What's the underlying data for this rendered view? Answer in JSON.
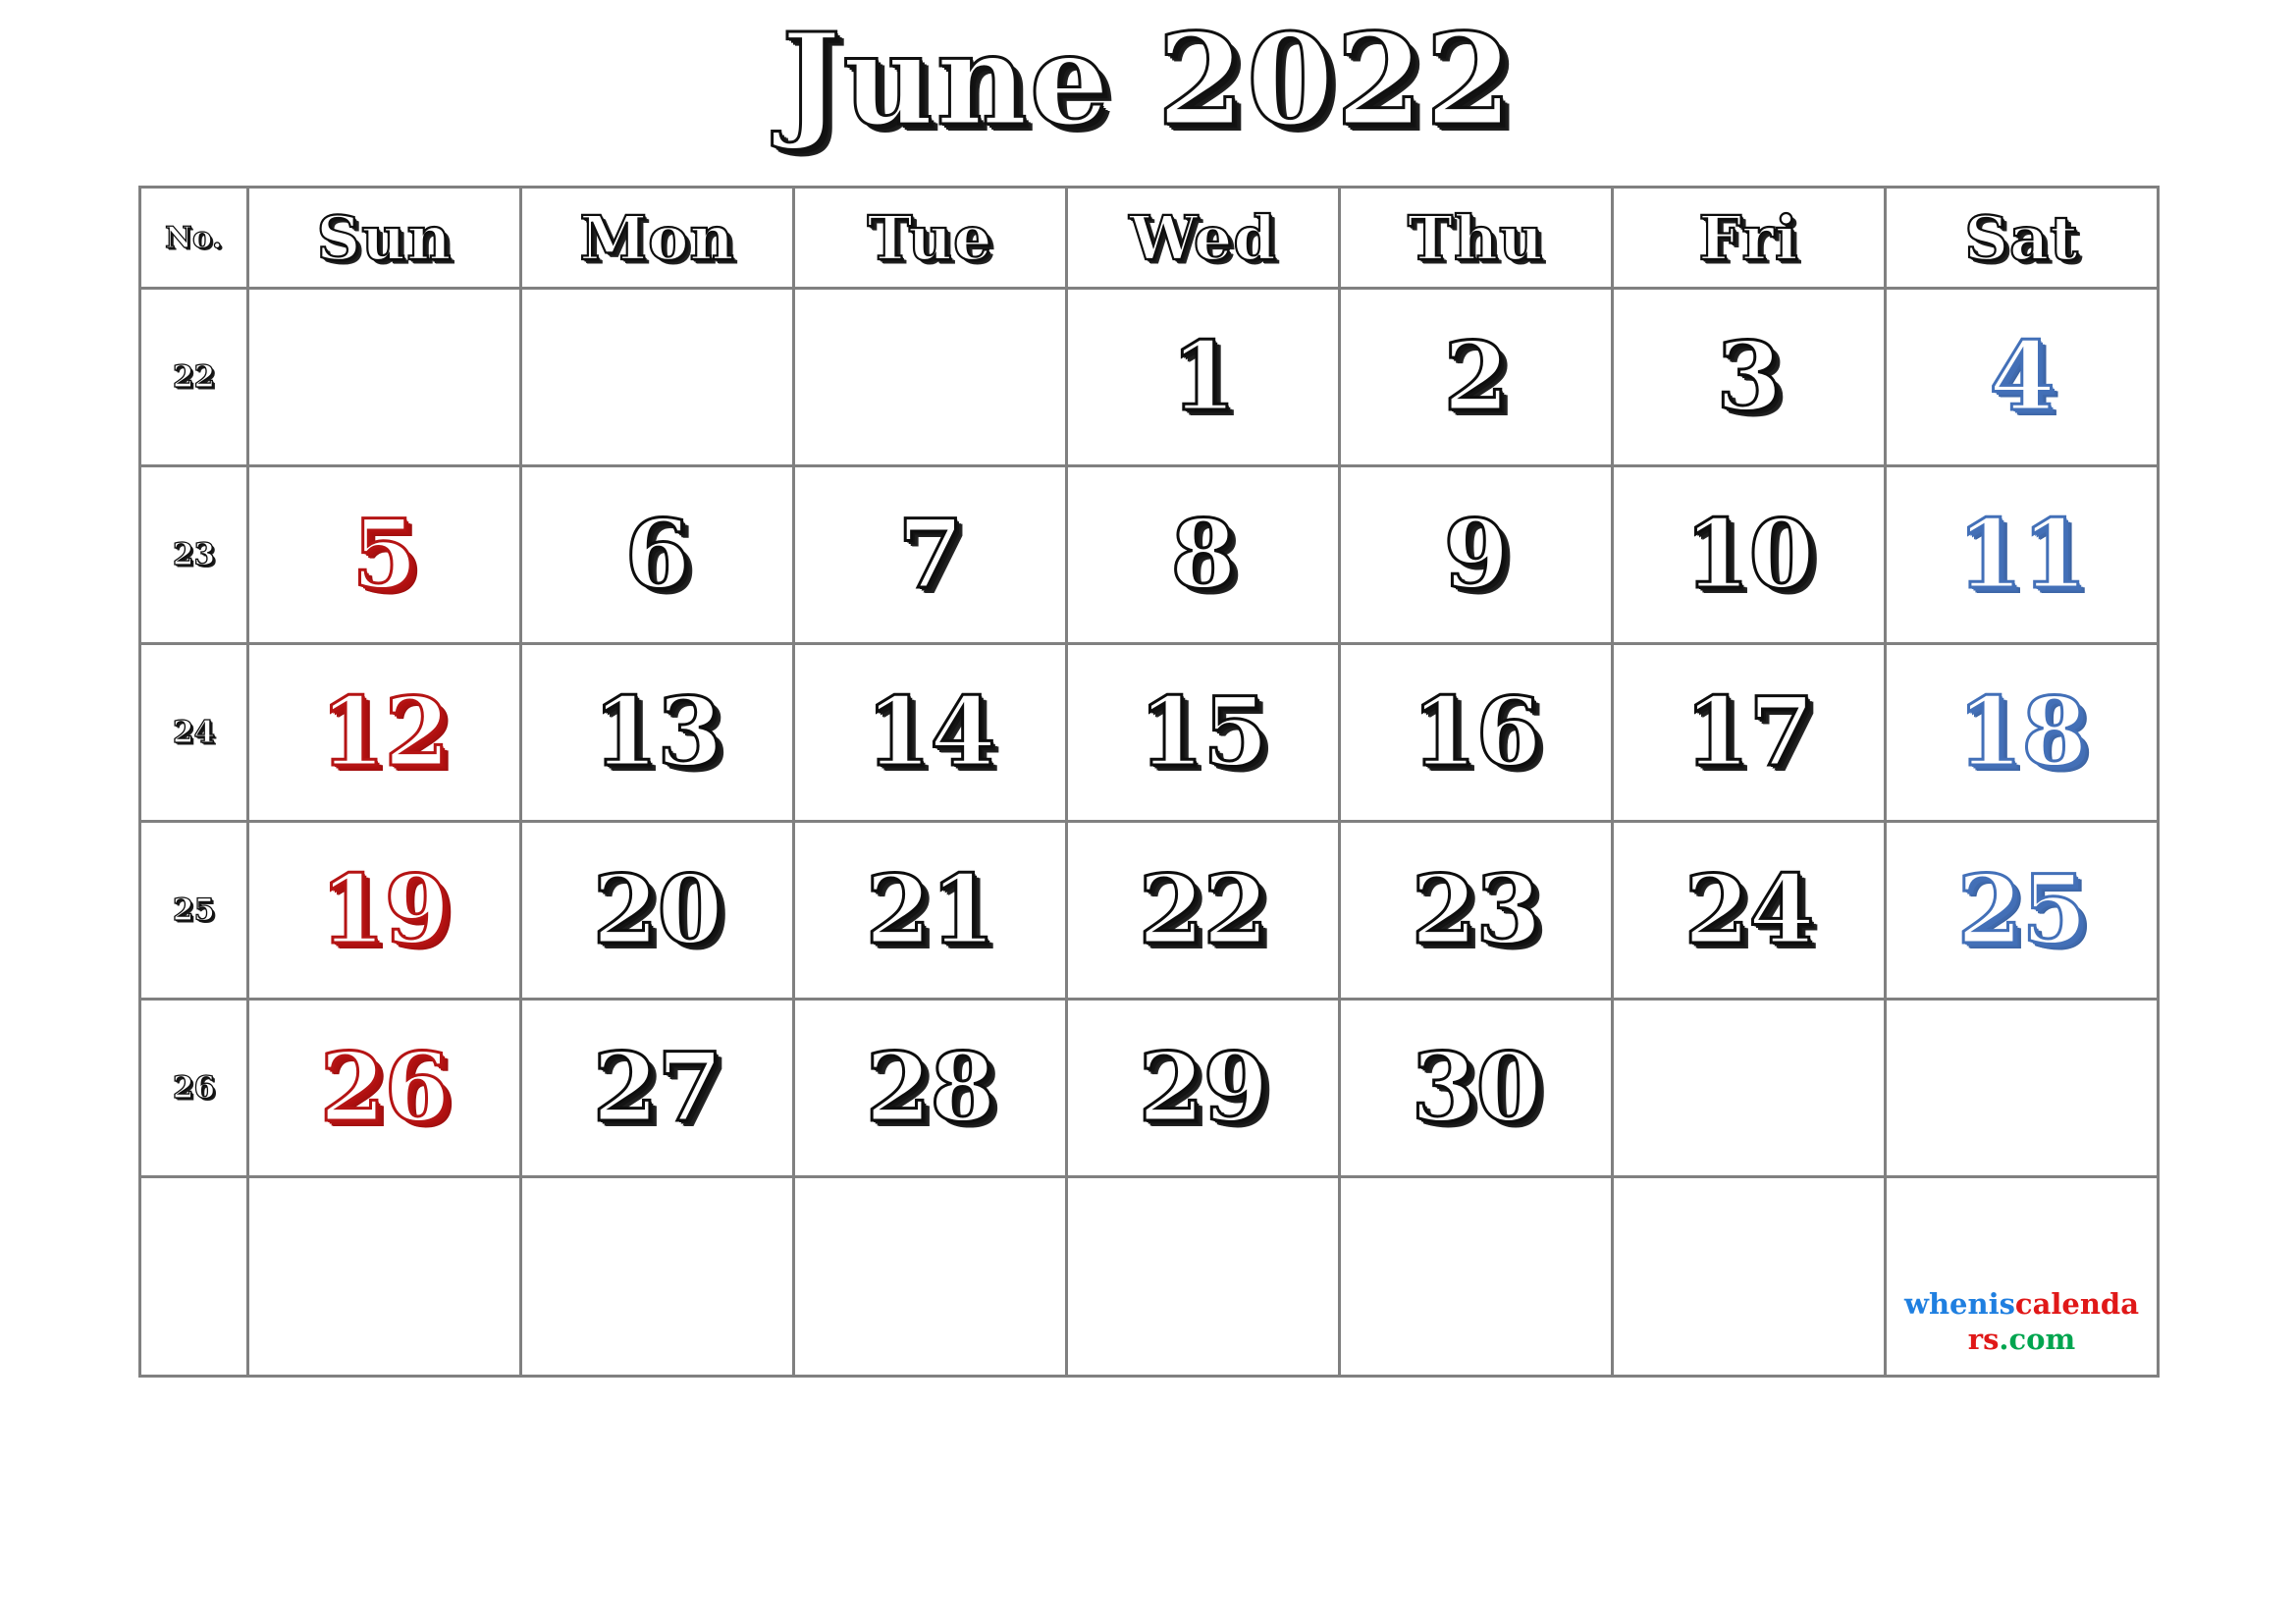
{
  "title": "June 2022",
  "header": {
    "week_number_label": "No.",
    "days": [
      "Sun",
      "Mon",
      "Tue",
      "Wed",
      "Thu",
      "Fri",
      "Sat"
    ]
  },
  "colors": {
    "sunday": "#b51414",
    "saturday": "#4370b8",
    "weekday": "#101010",
    "grid_border": "#808080",
    "watermark_blue": "#1f7fe0",
    "watermark_red": "#e01818",
    "watermark_green": "#00a54f"
  },
  "weeks": [
    {
      "number": "22",
      "days": [
        {
          "label": "",
          "color": "blank"
        },
        {
          "label": "",
          "color": "blank"
        },
        {
          "label": "",
          "color": "blank"
        },
        {
          "label": "1",
          "color": "black"
        },
        {
          "label": "2",
          "color": "black"
        },
        {
          "label": "3",
          "color": "black"
        },
        {
          "label": "4",
          "color": "blue"
        }
      ]
    },
    {
      "number": "23",
      "days": [
        {
          "label": "5",
          "color": "red"
        },
        {
          "label": "6",
          "color": "black"
        },
        {
          "label": "7",
          "color": "black"
        },
        {
          "label": "8",
          "color": "black"
        },
        {
          "label": "9",
          "color": "black"
        },
        {
          "label": "10",
          "color": "black"
        },
        {
          "label": "11",
          "color": "blue"
        }
      ]
    },
    {
      "number": "24",
      "days": [
        {
          "label": "12",
          "color": "red"
        },
        {
          "label": "13",
          "color": "black"
        },
        {
          "label": "14",
          "color": "black"
        },
        {
          "label": "15",
          "color": "black"
        },
        {
          "label": "16",
          "color": "black"
        },
        {
          "label": "17",
          "color": "black"
        },
        {
          "label": "18",
          "color": "blue"
        }
      ]
    },
    {
      "number": "25",
      "days": [
        {
          "label": "19",
          "color": "red"
        },
        {
          "label": "20",
          "color": "black"
        },
        {
          "label": "21",
          "color": "black"
        },
        {
          "label": "22",
          "color": "black"
        },
        {
          "label": "23",
          "color": "black"
        },
        {
          "label": "24",
          "color": "black"
        },
        {
          "label": "25",
          "color": "blue"
        }
      ]
    },
    {
      "number": "26",
      "days": [
        {
          "label": "26",
          "color": "red"
        },
        {
          "label": "27",
          "color": "black"
        },
        {
          "label": "28",
          "color": "black"
        },
        {
          "label": "29",
          "color": "black"
        },
        {
          "label": "30",
          "color": "black"
        },
        {
          "label": "",
          "color": "blank"
        },
        {
          "label": "",
          "color": "blank"
        }
      ]
    },
    {
      "number": "",
      "days": [
        {
          "label": "",
          "color": "blank"
        },
        {
          "label": "",
          "color": "blank"
        },
        {
          "label": "",
          "color": "blank"
        },
        {
          "label": "",
          "color": "blank"
        },
        {
          "label": "",
          "color": "blank"
        },
        {
          "label": "",
          "color": "blank"
        },
        {
          "label": "",
          "color": "blank"
        }
      ]
    }
  ],
  "watermark": {
    "part1": "whenis",
    "part2": "calendars",
    "part3": ".com"
  }
}
